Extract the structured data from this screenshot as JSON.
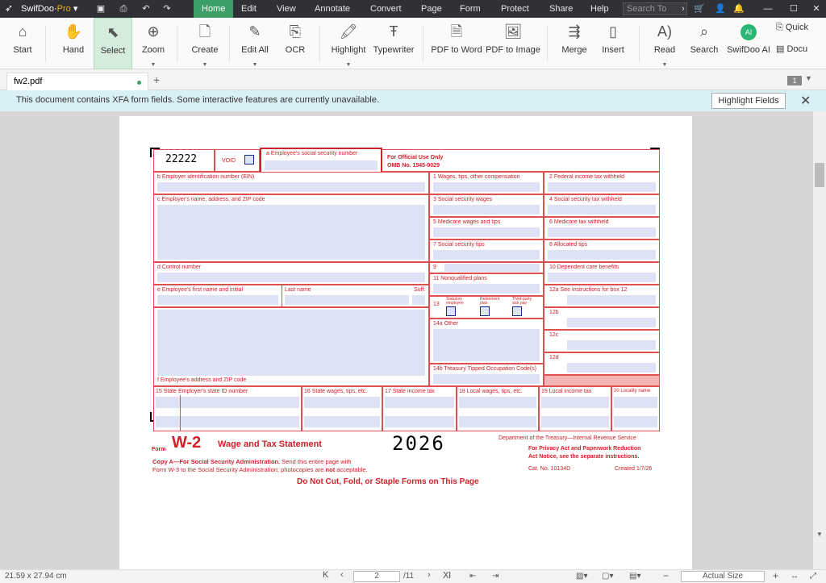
{
  "app": {
    "name": "SwifDoo",
    "tier": "Pro"
  },
  "menu": [
    "Home",
    "Edit",
    "View",
    "Annotate",
    "Convert",
    "Page",
    "Form",
    "Protect",
    "Share",
    "Help"
  ],
  "search": {
    "placeholder": "Search To"
  },
  "ribbon": {
    "start": "Start",
    "hand": "Hand",
    "select": "Select",
    "zoom": "Zoom",
    "create": "Create",
    "editall": "Edit All",
    "ocr": "OCR",
    "highlight": "Highlight",
    "typewriter": "Typewriter",
    "pdf2word": "PDF to Word",
    "pdf2img": "PDF to Image",
    "merge": "Merge",
    "insert": "Insert",
    "read": "Read",
    "search": "Search",
    "ai": "SwifDoo AI",
    "quick": "Quick",
    "docu": "Docu"
  },
  "tab": {
    "name": "fw2.pdf",
    "page_count_badge": "1"
  },
  "xfa": {
    "message": "This document contains XFA form fields. Some interactive features are currently unavailable.",
    "button": "Highlight Fields"
  },
  "status": {
    "size": "21.59 x 27.94 cm",
    "page": "2",
    "total": "/11",
    "zoom": "Actual Size"
  },
  "form": {
    "code": "22222",
    "void": "VOID",
    "a": "a  Employee's social security number",
    "official": "For Official Use Only",
    "omb": "OMB No. 1545-0029",
    "b": "b  Employer identification number (EIN)",
    "c": "c  Employer's name, address, and ZIP code",
    "d": "d  Control number",
    "e": "e  Employee's first name and initial",
    "last": "Last name",
    "suff": "Suff.",
    "f": "f  Employee's address and ZIP code",
    "b1": "1   Wages, tips, other compensation",
    "b2": "2   Federal income tax withheld",
    "b3": "3   Social security wages",
    "b4": "4   Social security tax withheld",
    "b5": "5   Medicare wages and tips",
    "b6": "6   Medicare tax withheld",
    "b7": "7   Social security tips",
    "b8": "8   Allocated tips",
    "b9": "9",
    "b10": "10   Dependent care benefits",
    "b11": "11   Nonqualified plans",
    "b12a": "12a  See instructions for box 12",
    "b13": "13",
    "stat": "Statutory employee",
    "ret": "Retirement plan",
    "tp": "Third-party sick pay",
    "b12b": "12b",
    "b14a": "14a  Other",
    "b12c": "12c",
    "b12d": "12d",
    "b14b": "14b  Treasury Tipped Occupation Code(s)",
    "b15": "15  State      Employer's state ID number",
    "b16": "16  State wages, tips, etc.",
    "b17": "17  State income tax",
    "b18": "18  Local wages, tips, etc.",
    "b19": "19  Local income tax",
    "b20": "20  Locality name",
    "formword": "Form",
    "w2": "W-2",
    "title": "Wage and Tax Statement",
    "year": "2026",
    "dept": "Department of the Treasury—Internal Revenue Service",
    "privacy1": "For Privacy Act and Paperwork Reduction",
    "privacy2": "Act Notice, see the separate instructions.",
    "copy_a": "Copy A—For Social Security Administration.",
    "copy_a2": " Send this entire page with",
    "copy_b": "Form W-3 to the Social Security Administration; photocopies are ",
    "not": "not",
    "acc": " acceptable.",
    "cat": "Cat. No. 10134D",
    "created": "Created 1/7/26",
    "donot": "Do Not Cut, Fold, or Staple Forms on This Page"
  }
}
